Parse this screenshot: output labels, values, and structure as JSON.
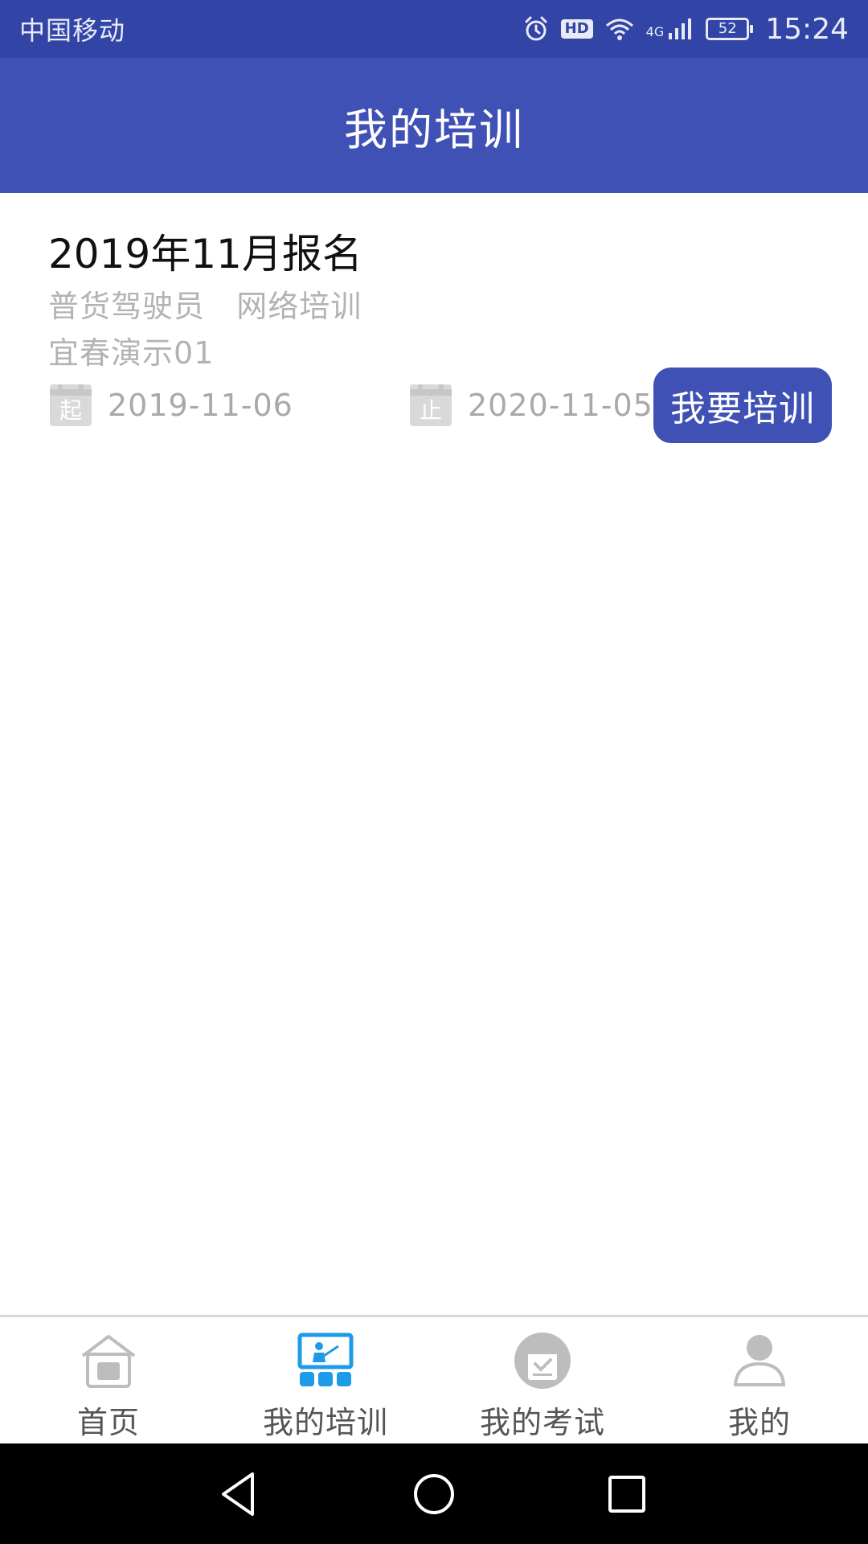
{
  "status_bar": {
    "carrier": "中国移动",
    "hd": "HD",
    "network": "4G",
    "battery": "52",
    "time": "15:24",
    "icons": [
      "alarm-icon",
      "hd-icon",
      "wifi-icon",
      "signal-icon",
      "battery-icon"
    ]
  },
  "app_bar": {
    "title": "我的培训"
  },
  "training": {
    "title": "2019年11月报名",
    "subtitle": "普货驾驶员   网络培训",
    "org": "宜春演示01",
    "start_icon_char": "起",
    "start_date": "2019-11-06",
    "end_icon_char": "止",
    "end_date": "2020-11-05",
    "button_label": "我要培训"
  },
  "bottom_nav": {
    "items": [
      {
        "label": "首页",
        "icon": "home-icon",
        "active": false
      },
      {
        "label": "我的培训",
        "icon": "training-icon",
        "active": true
      },
      {
        "label": "我的考试",
        "icon": "exam-icon",
        "active": false
      },
      {
        "label": "我的",
        "icon": "profile-icon",
        "active": false
      }
    ]
  },
  "colors": {
    "status_bar": "#3244a6",
    "primary": "#3f51b5",
    "active_icon": "#1e9be8",
    "muted_text": "#b3b3b3"
  }
}
